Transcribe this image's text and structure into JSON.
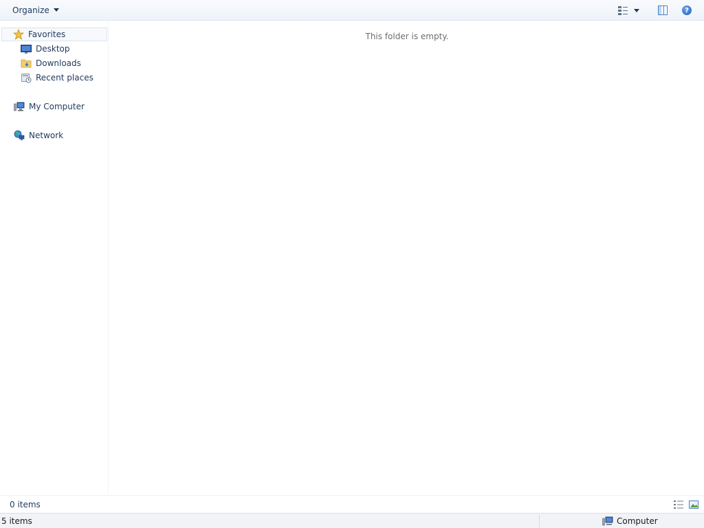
{
  "toolbar": {
    "organize_label": "Organize",
    "organize_icon": "chevron-down-icon",
    "views_icon": "change-view-icon",
    "pane_icon": "preview-pane-icon",
    "help_icon": "help-icon",
    "help_glyph": "?"
  },
  "nav": {
    "favorites": {
      "label": "Favorites",
      "icon": "star-icon"
    },
    "favorites_items": [
      {
        "label": "Desktop",
        "icon": "desktop-icon"
      },
      {
        "label": "Downloads",
        "icon": "downloads-folder-icon"
      },
      {
        "label": "Recent places",
        "icon": "recent-places-icon"
      }
    ],
    "computer": {
      "label": "My Computer",
      "icon": "computer-icon"
    },
    "network": {
      "label": "Network",
      "icon": "network-icon"
    }
  },
  "content": {
    "empty_message": "This folder is empty."
  },
  "details": {
    "item_count": "0 items"
  },
  "status": {
    "left_text": "5 items",
    "zone_label": "Computer"
  },
  "colors": {
    "text": "#1e395b",
    "muted": "#6d6d6d",
    "accent": "#1f5fb8"
  }
}
